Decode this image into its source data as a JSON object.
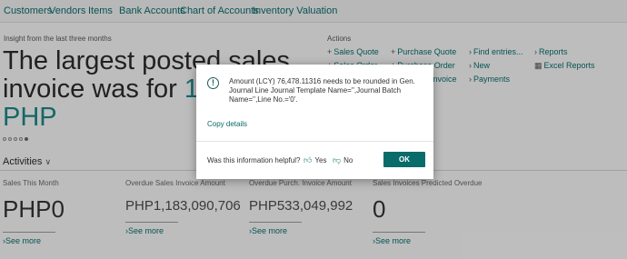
{
  "nav": {
    "items": [
      "Customers",
      "Vendors",
      "Items",
      "Bank Accounts",
      "Chart of Accounts",
      "Inventory Valuation"
    ]
  },
  "insight": {
    "caption": "Insight from the last three months",
    "headline_line1": "The largest posted sales",
    "headline_line2_prefix": "invoice was for",
    "headline_line2_value": "199,",
    "headline_line3": "PHP"
  },
  "actions": {
    "heading": "Actions",
    "items": [
      "Sales Quote",
      "Sales Order",
      "Purchase Quote",
      "Purchase Order",
      "Invoice",
      "Find entries...",
      "New",
      "Payments",
      "Reports",
      "Excel Reports"
    ]
  },
  "activities": {
    "title": "Activities",
    "tiles": [
      {
        "label": "Sales This Month",
        "value": "PHP0",
        "more": "See more"
      },
      {
        "label": "Overdue Sales Invoice Amount",
        "value": "PHP1,183,090,706",
        "more": "See more"
      },
      {
        "label": "Overdue Purch. Invoice Amount",
        "value": "PHP533,049,992",
        "more": "See more"
      },
      {
        "label": "Sales Invoices Predicted Overdue",
        "value": "0",
        "more": "See more"
      }
    ]
  },
  "dialog": {
    "message": "Amount (LCY) 76,478.11316 needs to be rounded in Gen. Journal Line Journal Template Name='',Journal Batch Name='',Line No.='0'.",
    "copy_details": "Copy details",
    "helpful_question": "Was this information helpful?",
    "yes": "Yes",
    "no": "No",
    "ok": "OK",
    "icon": "info-icon"
  }
}
